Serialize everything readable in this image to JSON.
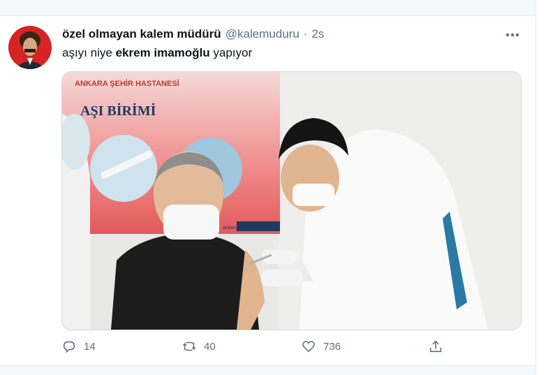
{
  "tweet": {
    "author_name": "özel olmayan kalem müdürü",
    "handle": "@kalemuduru",
    "separator": "·",
    "time": "2s",
    "text_before": "aşıyı niye ",
    "text_bold": "ekrem imamoğlu",
    "text_after": " yapıyor",
    "more_icon": "more-dots-icon"
  },
  "media": {
    "banner_line1": "ANKARA ŞEHİR HASTANESİ",
    "banner_line2": "AŞI BİRİMİ",
    "banner_footer": "ankarasehirhast"
  },
  "actions": {
    "reply_count": "14",
    "retweet_count": "40",
    "like_count": "736",
    "reply_icon": "reply-icon",
    "retweet_icon": "retweet-icon",
    "like_icon": "heart-icon",
    "share_icon": "share-icon"
  },
  "colors": {
    "secondary_text": "#5b7083",
    "border": "#e6ecf0",
    "banner_red": "#c0392b"
  }
}
